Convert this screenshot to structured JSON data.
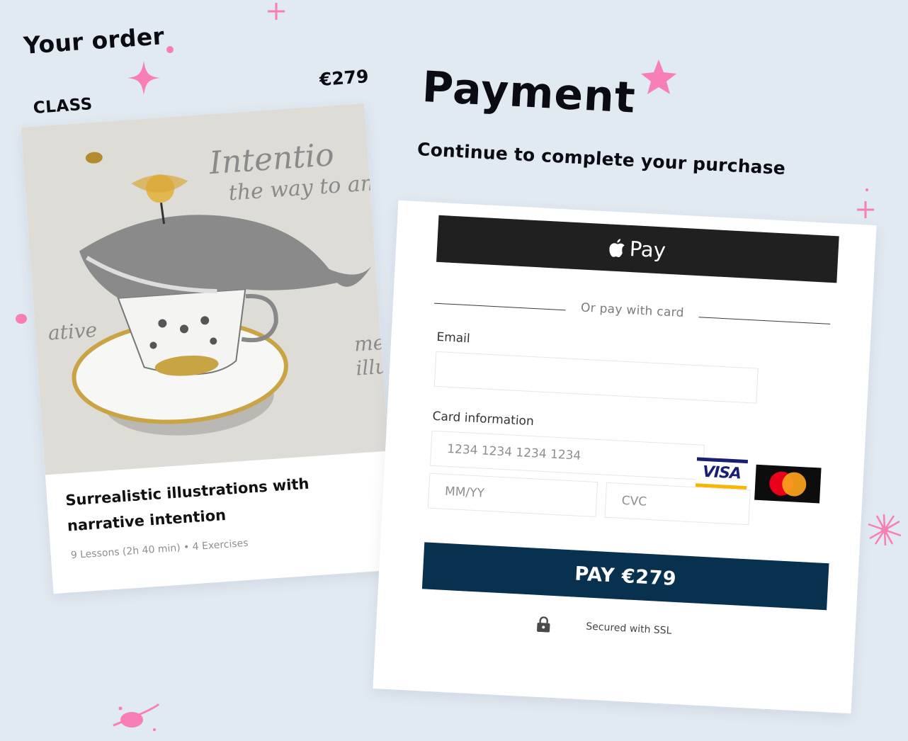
{
  "order": {
    "heading": "Your order",
    "class_label": "CLASS",
    "price": "€279",
    "card": {
      "image_text_1": "Intentio",
      "image_text_2": "the way to an",
      "image_text_3": "ative",
      "image_text_4": "mea",
      "image_text_5": "illu",
      "title": "Surrealistic illustrations with narrative intention",
      "meta": "9 Lessons (2h 40 min) • 4 Exercises"
    }
  },
  "payment": {
    "title": "Payment",
    "subtitle": "Continue to complete your purchase",
    "apple_pay_label": "Pay",
    "divider_text": "Or pay with card",
    "email_label": "Email",
    "email_value": "",
    "card_info_label": "Card information",
    "card_number_placeholder": "1234 1234 1234 1234",
    "expiry_placeholder": "MM/YY",
    "cvc_placeholder": "CVC",
    "visa_label": "VISA",
    "pay_button_label": "PAY €279",
    "secure_text": "Secured with SSL"
  },
  "colors": {
    "background": "#e1e9f1",
    "pay_button": "#07314f",
    "apple_button": "#202020",
    "decoration_pink": "#f77fb5"
  }
}
